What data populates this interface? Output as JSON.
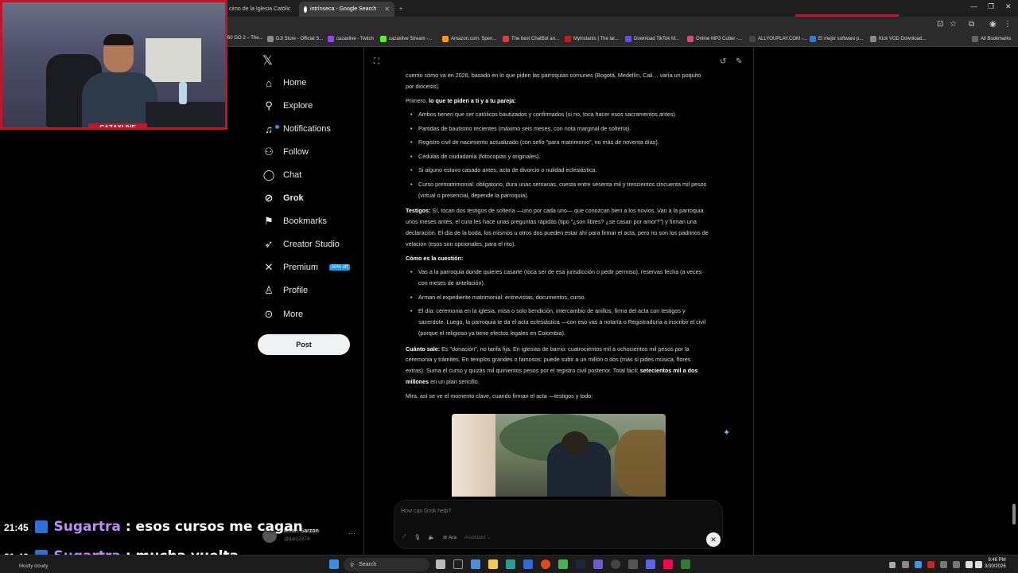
{
  "browser": {
    "tabs": [
      {
        "label": "cimo de la Iglesia Católic",
        "active": false
      },
      {
        "label": "intrínseca - Google Search",
        "active": false
      }
    ],
    "new_tab_icon": "plus-icon",
    "bookmarks": [
      {
        "label": "60 GO 2 – The...",
        "color": "#5a5a5a"
      },
      {
        "label": "DJI Store - Official S...",
        "color": "#888888"
      },
      {
        "label": "cazaxlive - Twitch",
        "color": "#9146ff"
      },
      {
        "label": "cazaxlive Stream -...",
        "color": "#53fc18"
      },
      {
        "label": "Amazon.com. Spen...",
        "color": "#ff9900"
      },
      {
        "label": "The best ChatBot an...",
        "color": "#e03a3a"
      },
      {
        "label": "Myinstants | The lar...",
        "color": "#d01818"
      },
      {
        "label": "Download TikTok M...",
        "color": "#6b4ce6"
      },
      {
        "label": "Online MP3 Cutter -...",
        "color": "#e0477a"
      },
      {
        "label": "ALLYOUPLAY.COM -...",
        "color": "#444444"
      },
      {
        "label": "El mejor software p...",
        "color": "#2f7bd6"
      },
      {
        "label": "Kick VOD Download...",
        "color": "#888888"
      }
    ],
    "all_bookmarks": "All Bookmarks"
  },
  "webcam": {
    "name_tag": "CAZAXLIVE"
  },
  "nav": {
    "items": [
      {
        "label": "Home",
        "icon": "home-icon",
        "glyph": "⌂"
      },
      {
        "label": "Explore",
        "icon": "search-icon",
        "glyph": "⚲"
      },
      {
        "label": "Notifications",
        "icon": "bell-icon",
        "glyph": "🔔"
      },
      {
        "label": "Follow",
        "icon": "person-plus-icon",
        "glyph": "⚇"
      },
      {
        "label": "Chat",
        "icon": "chat-icon",
        "glyph": "◯"
      },
      {
        "label": "Grok",
        "icon": "grok-icon",
        "glyph": "⊘"
      },
      {
        "label": "Bookmarks",
        "icon": "bookmark-icon",
        "glyph": "⚑"
      },
      {
        "label": "Creator Studio",
        "icon": "rocket-icon",
        "glyph": "➶"
      },
      {
        "label": "Premium",
        "icon": "x-logo-icon",
        "glyph": "✕"
      },
      {
        "label": "Profile",
        "icon": "person-icon",
        "glyph": "⚲"
      },
      {
        "label": "More",
        "icon": "more-circle-icon",
        "glyph": "⊙"
      }
    ],
    "premium_badge": "50% off",
    "post_label": "Post"
  },
  "user": {
    "name": "Milan Garzon",
    "handle": "@juli12274"
  },
  "content": {
    "intro": "cuento cómo va en 2026, basado en lo que piden las parroquias comunes (Bogotá, Medellín, Cali… varía un poquito por diócesis).",
    "first_prefix": "Primero, ",
    "first_bold": "lo que te piden a ti y a tu pareja:",
    "requirements": [
      "Ambos tienen que ser católicos bautizados y confirmados (si no, toca hacer esos sacramentos antes).",
      "Partidas de bautismo recientes (máximo seis meses, con nota marginal de soltería).",
      "Registro civil de nacimiento actualizado (con sello \"para matrimonio\", no más de noventa días).",
      "Cédulas de ciudadanía (fotocopias y originales).",
      "Si alguno estuvo casado antes, acta de divorcio o nulidad eclesiástica.",
      "Curso prematrimonial: obligatorio, dura unas semanas, cuesta entre sesenta mil y trescientos cincuenta mil pesos (virtual o presencial, depende la parroquia)."
    ],
    "testigos_bold": "Testigos:",
    "testigos_text": " Sí, tocan dos testigos de soltería —uno por cada uno— que conozcan bien a los novios. Van a la parroquia unos meses antes, el cura les hace unas preguntas rápidas (tipo \"¿son libres? ¿se casan por amor?\") y firman una declaración. El día de la boda, los mismos u otros dos pueden estar ahí para firmar el acta, pero no son los padrinos de velación (esos son opcionales, para el rito).",
    "como_bold": "Cómo es la cuestión:",
    "steps": [
      "Vas a la parroquia donde quieres casarte (toca ser de esa jurisdicción o pedir permiso), reservas fecha (a veces con meses de antelación).",
      "Arman el expediente matrimonial: entrevistas, documentos, curso.",
      "El día: ceremonia en la iglesia, misa o solo bendición, intercambio de anillos, firma del acta con testigos y sacerdote. Luego, la parroquia te da el acta eclesiástica —con eso vas a notaría o Registraduría a inscribir el civil (porque el religioso ya tiene efectos legales en Colombia)."
    ],
    "cuanto_bold": "Cuánto sale:",
    "cuanto_text": " Es \"donación\", no tarifa fija. En iglesias de barrio: cuatrocientos mil a ochocientos mil pesos por la ceremonia y trámites. En templos grandes o famosos: puede subir a un millón o dos (más si pides música, flores extras). Suma el curso y quizás mil quinientos pesos por el registro civil posterior. Total fácil: ",
    "cuanto_bold2": "setecientos mil a dos millones",
    "cuanto_end": " en un plan sencillo.",
    "mira": "Mira, así se ve el momento clave, cuando firman el acta —testigos y todo:"
  },
  "composer": {
    "placeholder": "How can Grok help?",
    "model": "Ara",
    "mode": "Assistant",
    "close_icon": "close-icon"
  },
  "chat_overlay": [
    {
      "time": "21:45",
      "user": "Sugartra",
      "message": ": esos cursos me cagan"
    },
    {
      "time": "21:46",
      "user": "Sugartra",
      "message": ": mucha vuelta"
    }
  ],
  "taskbar": {
    "search_label": "Search",
    "weather": "Mostly cloudy",
    "time": "9:46 PM",
    "date": "3/30/2026"
  }
}
